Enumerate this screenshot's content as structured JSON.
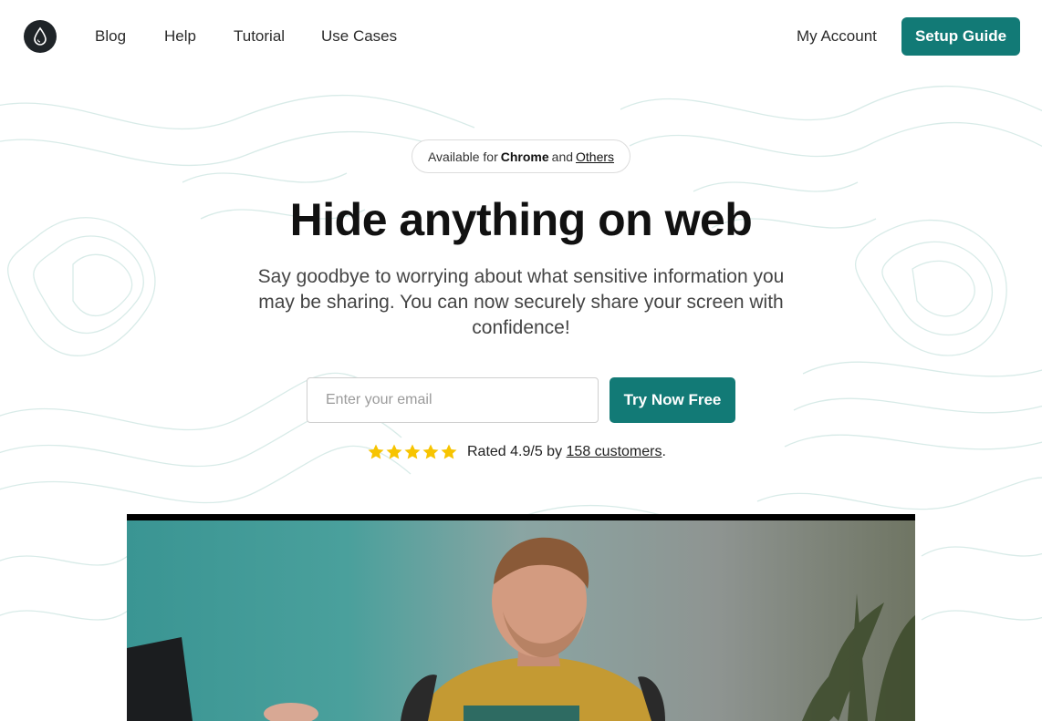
{
  "nav": {
    "links": [
      "Blog",
      "Help",
      "Tutorial",
      "Use Cases"
    ],
    "account": "My Account",
    "cta": "Setup Guide"
  },
  "hero": {
    "badge": {
      "prefix": "Available for",
      "chrome": "Chrome",
      "and": "and",
      "others": "Others"
    },
    "title": "Hide anything on web",
    "subtitle": "Say goodbye to worrying about what sensitive information you may be sharing. You can now securely share your screen with confidence!",
    "email_placeholder": "Enter your email",
    "try_button": "Try Now Free",
    "rating": {
      "stars": 5,
      "prefix": "Rated 4.9/5 by",
      "link": "158 customers",
      "suffix": "."
    }
  },
  "colors": {
    "accent": "#127a76",
    "star": "#f7c400",
    "logo_bg": "#1f2428"
  },
  "icons": {
    "logo": "droplet-icon",
    "star": "star-icon"
  },
  "video": {
    "description_icon": "video-player"
  }
}
